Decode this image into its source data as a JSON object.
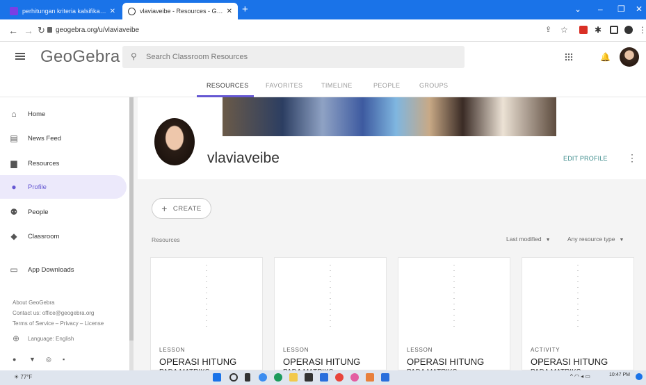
{
  "browser": {
    "tabs": [
      {
        "title": "perhitungan kriteria kalsifikasi ku",
        "active": false
      },
      {
        "title": "vlaviaveibe - Resources - GeoGebra",
        "active": true
      }
    ],
    "new_tab": "+",
    "url": "geogebra.org/u/vlaviaveibe"
  },
  "header": {
    "logo": "GeoGebra",
    "search_placeholder": "Search Classroom Resources"
  },
  "nav_tabs": [
    "RESOURCES",
    "FAVORITES",
    "TIMELINE",
    "PEOPLE",
    "GROUPS"
  ],
  "sidebar": {
    "items": [
      {
        "label": "Home",
        "icon": "home-icon"
      },
      {
        "label": "News Feed",
        "icon": "news-feed-icon"
      },
      {
        "label": "Resources",
        "icon": "resources-icon"
      },
      {
        "label": "Profile",
        "icon": "profile-icon"
      },
      {
        "label": "People",
        "icon": "people-icon"
      },
      {
        "label": "Classroom",
        "icon": "classroom-icon"
      },
      {
        "label": "App Downloads",
        "icon": "app-downloads-icon"
      }
    ],
    "footer": {
      "about": "About GeoGebra",
      "contact": "Contact us: office@geogebra.org",
      "terms": "Terms of Service – Privacy – License",
      "language": "Language: English"
    }
  },
  "profile": {
    "username": "vlaviaveibe",
    "edit_label": "EDIT PROFILE"
  },
  "create_label": "CREATE",
  "resources": {
    "section_label": "Resources",
    "sort_label": "Last modified",
    "type_filter_label": "Any resource type",
    "cards": [
      {
        "type": "LESSON",
        "title": "OPERASI HITUNG",
        "subtitle": "PADA MATRIKS"
      },
      {
        "type": "LESSON",
        "title": "OPERASI HITUNG",
        "subtitle": "PADA MATRIKS"
      },
      {
        "type": "LESSON",
        "title": "OPERASI HITUNG",
        "subtitle": "PADA MATRIKS"
      },
      {
        "type": "ACTIVITY",
        "title": "OPERASI HITUNG",
        "subtitle": "PADA MATRIKS"
      }
    ]
  },
  "taskbar": {
    "weather": "77°F",
    "time": "10:47 PM"
  },
  "colors": {
    "accent": "#6557d2",
    "browser_bar": "#1a73e8",
    "edit_profile": "#3b8b8b"
  }
}
